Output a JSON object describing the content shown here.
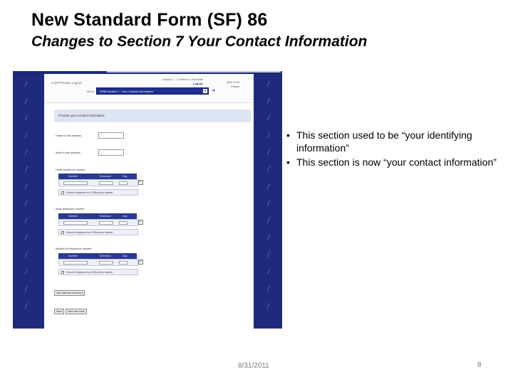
{
  "slide": {
    "title": "New Standard Form (SF) 86",
    "subtitle": "Changes to  Section 7 Your Contact Information",
    "bullets": [
      "This section used to be “your identifying information”",
      "This section is now “your contact information”"
    ],
    "bullet_glyph": "•",
    "date": "8/31/2011",
    "page_number": "8"
  },
  "screenshot": {
    "header": {
      "brand": "e-QIP  Privacy  Logout",
      "links": "Section 7 - Contact us  Schedule",
      "logout": "Logout",
      "meta_lines": [
        "6/8/2 10:05",
        "Privacy"
      ],
      "goto_label": "Go to",
      "goto_value": "SF86 Section 7 - Your Contact Information",
      "caret_icon": "chevron-down-icon",
      "go_icon": "arrow-right-icon"
    },
    "section_title": "Provide your contact information",
    "fields": [
      {
        "label": "Home e-mail address"
      },
      {
        "label": "Work e-mail address"
      }
    ],
    "phone_groups": [
      {
        "label": "Home telephone number",
        "col_number": "Number",
        "col_ext": "Extension",
        "col_day": "Day",
        "option": "Check if telephone is a DSN phone number"
      },
      {
        "label": "Work telephone number",
        "col_number": "Number",
        "col_ext": "Extension",
        "col_day": "Day",
        "option": "Check if telephone is a DSN phone number"
      },
      {
        "label": "Mobile/Cell telephone number",
        "col_number": "Number",
        "col_ext": "Extension",
        "col_day": "Day",
        "option": "Check if telephone is a DSN phone number"
      }
    ],
    "add_button": "Add Optional Comment",
    "save_button": "Save",
    "save_next_button": "Save and Next",
    "colors": {
      "frame": "#1d2a78",
      "section_bar": "#dfe4f5",
      "table_head": "#2a3a92"
    }
  }
}
